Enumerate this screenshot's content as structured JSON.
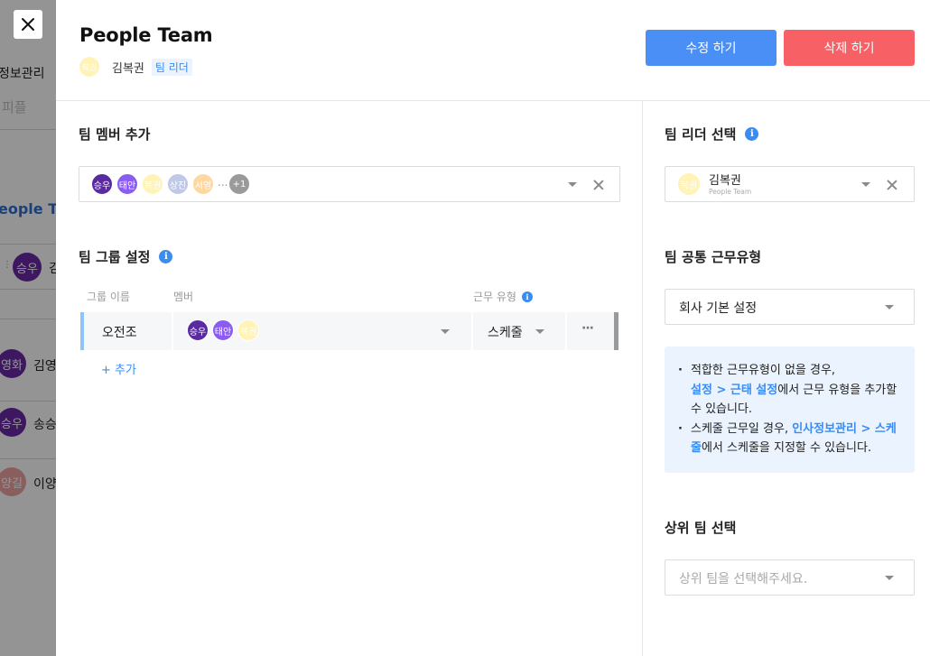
{
  "background": {
    "menu_text_1": "정보관리",
    "menu_text_2": "피플",
    "team_text": "eople Te",
    "rows": [
      {
        "avatar": "승우",
        "name": "김",
        "color": "#6a2aa8"
      },
      {
        "avatar": "영화",
        "name": "김영",
        "color": "#6a2aa8"
      },
      {
        "avatar": "승우",
        "name": "송승",
        "color": "#6a2aa8"
      },
      {
        "avatar": "양길",
        "name": "이양",
        "color": "#f0a2a2"
      }
    ]
  },
  "header": {
    "title": "People Team",
    "leader_avatar": "복권",
    "leader_name": "김복권",
    "leader_badge": "팀 리더",
    "edit_label": "수정 하기",
    "delete_label": "삭제 하기"
  },
  "members": {
    "title": "팀 멤버 추가",
    "avatars": [
      {
        "label": "승우",
        "color": "#5a2aa0"
      },
      {
        "label": "태안",
        "color": "#8b5cf0"
      },
      {
        "label": "복권",
        "color": "#fff3b8"
      },
      {
        "label": "상진",
        "color": "#c0c8e8"
      },
      {
        "label": "서영",
        "color": "#ffd7a0"
      }
    ],
    "ellipsis": "...",
    "more": "+1"
  },
  "groups": {
    "title": "팀 그룹 설정",
    "col_name": "그룹 이름",
    "col_member": "멤버",
    "col_work": "근무 유형",
    "rows": [
      {
        "name": "오전조",
        "avatars": [
          {
            "label": "승우",
            "color": "#5a2aa0"
          },
          {
            "label": "태안",
            "color": "#8b5cf0"
          },
          {
            "label": "복권",
            "color": "#fff3b8"
          }
        ],
        "work": "스케줄",
        "more_icon": "···"
      }
    ],
    "add_label": "+ 추가"
  },
  "leader_select": {
    "title": "팀 리더 선택",
    "avatar": "복권",
    "name": "김복권",
    "sub": "People Team"
  },
  "work_type": {
    "title": "팀 공통 근무유형",
    "value": "회사 기본 설정",
    "notice_1a": "적합한 근무유형이 없을 경우,",
    "notice_1_link": "설정 > 근태 설정",
    "notice_1b": "에서 근무 유형을 추가할 수 있습니다.",
    "notice_2a": "스케줄 근무일 경우, ",
    "notice_2_link": "인사정보관리 > 스케줄",
    "notice_2b": "에서 스케줄을 지정할 수 있습니다."
  },
  "parent_team": {
    "title": "상위 팀 선택",
    "placeholder": "상위 팀을 선택해주세요."
  }
}
